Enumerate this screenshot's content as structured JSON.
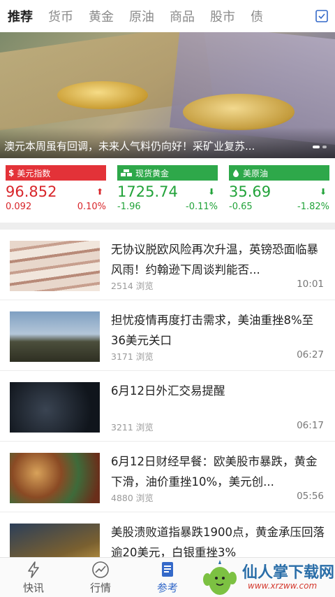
{
  "tabs": [
    "推荐",
    "货币",
    "黄金",
    "原油",
    "商品",
    "股市",
    "债"
  ],
  "banner": {
    "caption": "澳元本周虽有回调，未来人气料仍向好！采矿业复苏..."
  },
  "quotes": [
    {
      "label": "美元指数",
      "icon": "dollar-icon",
      "price": "96.852",
      "arrow": "⬆",
      "change": "0.092",
      "percent": "0.10%",
      "direction": "up"
    },
    {
      "label": "现货黄金",
      "icon": "gold-bars-icon",
      "price": "1725.74",
      "arrow": "⬇",
      "change": "-1.96",
      "percent": "-0.11%",
      "direction": "down"
    },
    {
      "label": "美原油",
      "icon": "oil-drop-icon",
      "price": "35.69",
      "arrow": "⬇",
      "change": "-0.65",
      "percent": "-1.82%",
      "direction": "down"
    }
  ],
  "news": [
    {
      "title": "无协议脱欧风险再次升温，英镑恐面临暴风雨！约翰逊下周谈判能否...",
      "views": "2514 浏览",
      "time": "10:01",
      "thumb": "pounds"
    },
    {
      "title": "担忧疫情再度打击需求，美油重挫8%至36美元关口",
      "views": "3171 浏览",
      "time": "06:27",
      "thumb": "oil"
    },
    {
      "title": "6月12日外汇交易提醒",
      "views": "3211 浏览",
      "time": "06:17",
      "thumb": "dice"
    },
    {
      "title": "6月12日财经早餐：欧美股市暴跌，黄金下滑，油价重挫10%，美元创...",
      "views": "4880 浏览",
      "time": "05:56",
      "thumb": "food"
    },
    {
      "title": "美股溃败道指暴跌1900点，黄金承压回落逾20美元，白银重挫3%",
      "views": "",
      "time": "",
      "thumb": "gold"
    }
  ],
  "bottom_nav": [
    {
      "label": "快讯",
      "icon": "flash-icon"
    },
    {
      "label": "行情",
      "icon": "trend-icon"
    },
    {
      "label": "参考",
      "icon": "document-icon"
    },
    {
      "label": "",
      "icon": "cactus-icon"
    },
    {
      "label": "",
      "icon": "user-icon"
    }
  ],
  "watermark": {
    "text": "仙人掌下载网",
    "url": "www.xrzww.com"
  },
  "colors": {
    "up": "#d8262b",
    "down": "#22a33a",
    "accent": "#3469c9"
  }
}
